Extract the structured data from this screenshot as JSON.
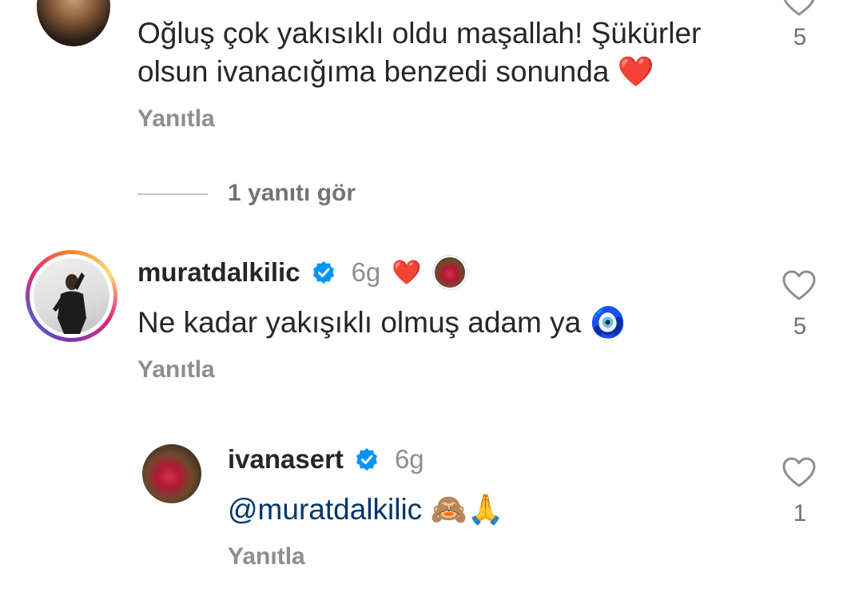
{
  "comments": [
    {
      "text_line1": "Oğluş çok yakısıklı oldu maşallah! Şükürler",
      "text_line2": "olsun ivanacığıma benzedi sonunda",
      "text_emoji": "❤️",
      "reply_label": "Yanıtla",
      "likes": "5",
      "view_replies": "1 yanıtı gör"
    },
    {
      "username": "muratdalkilic",
      "time": "6g",
      "badge_heart": "❤️",
      "text": "Ne kadar yakışıklı olmuş adam ya",
      "text_emoji": "🧿",
      "reply_label": "Yanıtla",
      "likes": "5"
    },
    {
      "username": "ivanasert",
      "time": "6g",
      "mention": "@muratdalkilic",
      "text_emoji": "🙈🙏",
      "reply_label": "Yanıtla",
      "likes": "1"
    }
  ],
  "icons": {
    "verified": "verified-badge-icon",
    "like": "heart-outline-icon",
    "liked_by_author": "author-heart-icon"
  },
  "colors": {
    "verified_blue": "#0095f6",
    "heart_red": "#ed1c3b",
    "mention_blue": "#00376b",
    "secondary_text": "#8e8e8e"
  }
}
